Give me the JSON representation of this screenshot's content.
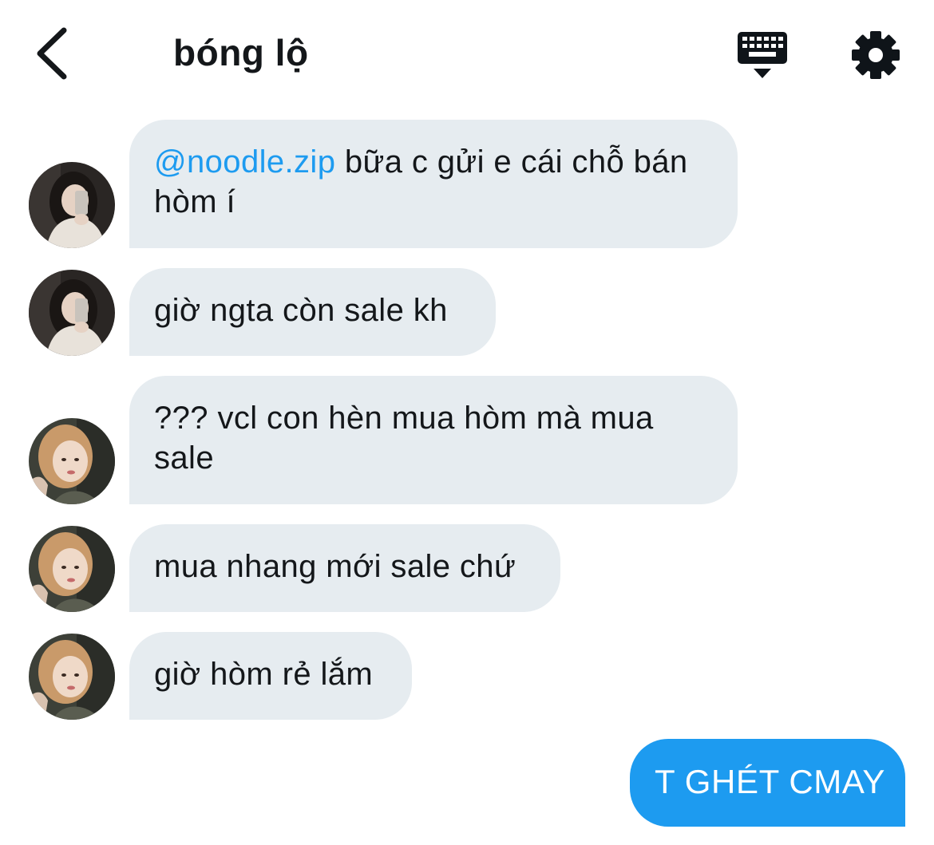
{
  "header": {
    "title": "bóng lộ",
    "back_icon": "chevron-left-icon",
    "keyboard_icon": "keyboard-icon",
    "settings_icon": "gear-icon"
  },
  "colors": {
    "accent": "#1d9bf0",
    "received_bubble": "#e6ecf0",
    "text": "#14171a"
  },
  "messages": [
    {
      "sender": "received",
      "avatar": "avatar-dark-hair",
      "mention": "@noodle.zip",
      "text": " bữa c gửi e cái chỗ bán hòm í"
    },
    {
      "sender": "received",
      "avatar": "avatar-dark-hair",
      "text": "giờ ngta còn sale kh"
    },
    {
      "sender": "received",
      "avatar": "avatar-blonde-hair",
      "text": "??? vcl con hèn mua hòm mà mua sale"
    },
    {
      "sender": "received",
      "avatar": "avatar-blonde-hair",
      "text": "mua nhang mới sale chứ"
    },
    {
      "sender": "received",
      "avatar": "avatar-blonde-hair",
      "text": "giờ hòm rẻ lắm"
    },
    {
      "sender": "sent",
      "text": "T GHÉT CMAY"
    }
  ]
}
